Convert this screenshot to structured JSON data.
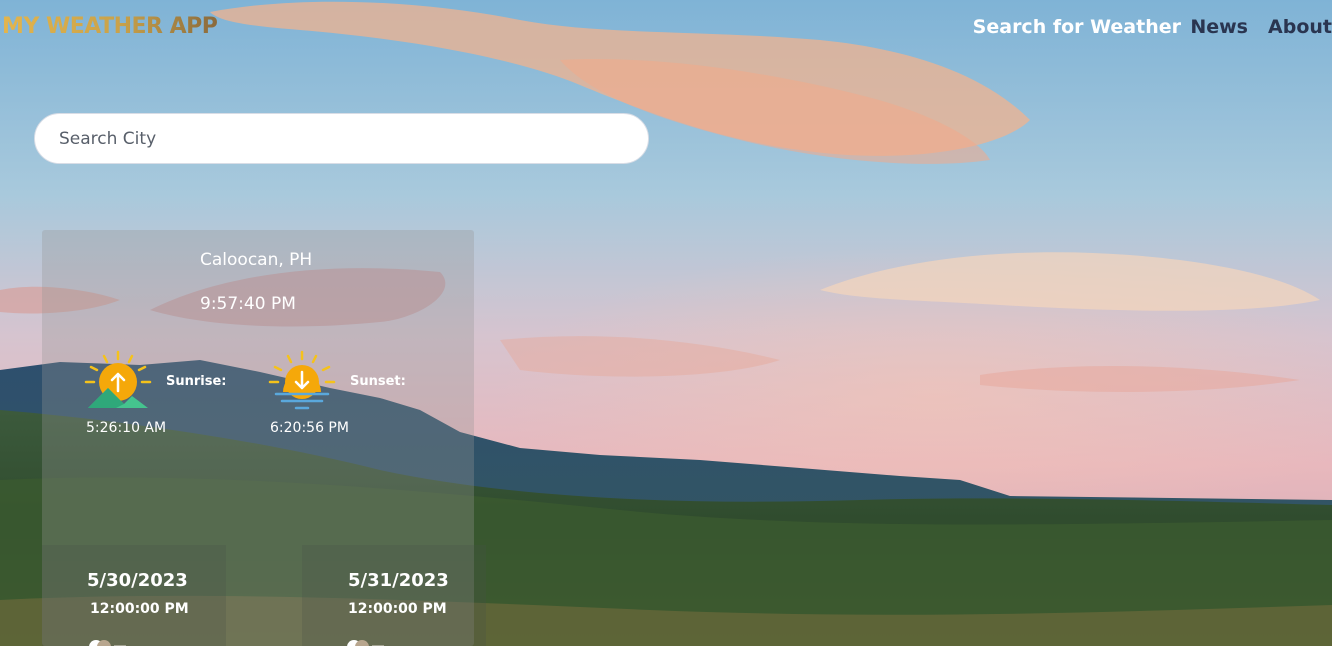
{
  "header": {
    "app_title": "MY WEATHER APP",
    "nav": [
      "Search for Weather",
      "News",
      "About"
    ]
  },
  "search": {
    "placeholder": "Search City"
  },
  "current": {
    "city": "Caloocan, PH",
    "time": "9:57:40 PM",
    "sunrise": {
      "label": "Sunrise:",
      "time": "5:26:10 AM",
      "icon": "sunrise-icon"
    },
    "sunset": {
      "label": "Sunset:",
      "time": "6:20:56 PM",
      "icon": "sunset-icon"
    }
  },
  "forecast": [
    {
      "date": "5/30/2023",
      "time": "12:00:00 PM",
      "icon": "weather-icon"
    },
    {
      "date": "5/31/2023",
      "time": "12:00:00 PM",
      "icon": "weather-icon"
    }
  ],
  "colors": {
    "title_gold": "#e4b54c",
    "nav_active": "#ffffff",
    "nav_dark": "#2a3550",
    "sun": "#f5a80a",
    "mountain": "#3fbf8f"
  }
}
